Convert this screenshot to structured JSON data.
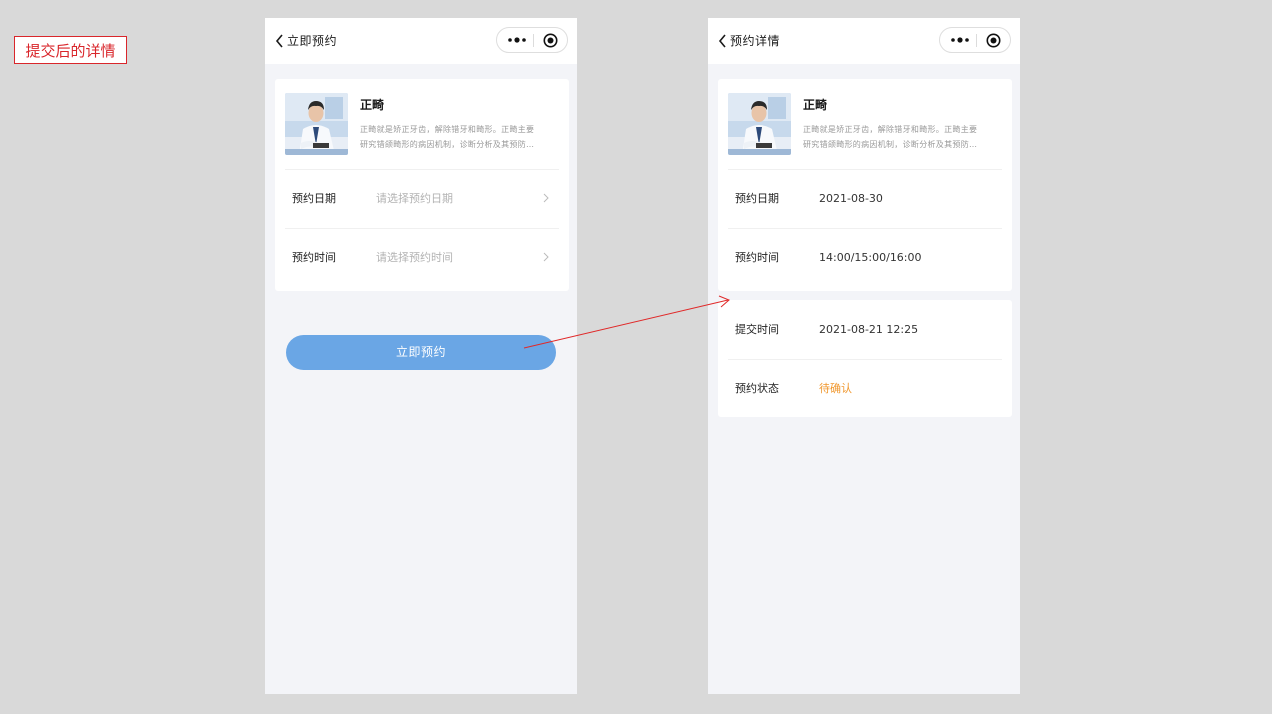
{
  "annotation": {
    "label": "提交后的详情",
    "color": "#d9262b"
  },
  "left_screen": {
    "nav_title": "立即预约",
    "doctor": {
      "name": "正畸",
      "desc_line1": "正畸就是矫正牙齿，解除错牙和畸形。正畸主要",
      "desc_line2": "研究错颌畸形的病因机制，诊断分析及其预防…"
    },
    "form": {
      "date_label": "预约日期",
      "date_placeholder": "请选择预约日期",
      "time_label": "预约时间",
      "time_placeholder": "请选择预约时间"
    },
    "submit_label": "立即预约"
  },
  "right_screen": {
    "nav_title": "预约详情",
    "doctor": {
      "name": "正畸",
      "desc_line1": "正畸就是矫正牙齿，解除错牙和畸形。正畸主要",
      "desc_line2": "研究错颌畸形的病因机制，诊断分析及其预防…"
    },
    "booking": {
      "date_label": "预约日期",
      "date_value": "2021-08-30",
      "time_label": "预约时间",
      "time_value": "14:00/15:00/16:00"
    },
    "submission": {
      "submit_time_label": "提交时间",
      "submit_time_value": "2021-08-21  12:25",
      "status_label": "预约状态",
      "status_value": "待确认"
    }
  },
  "icons": {
    "back": "chevron-left-icon",
    "more": "more-dots-icon",
    "close": "target-circle-icon",
    "chevron": "chevron-right-icon"
  },
  "colors": {
    "primary_button": "#6aa6e5",
    "status_pending": "#f0972d",
    "page_bg": "#f3f4f8"
  }
}
